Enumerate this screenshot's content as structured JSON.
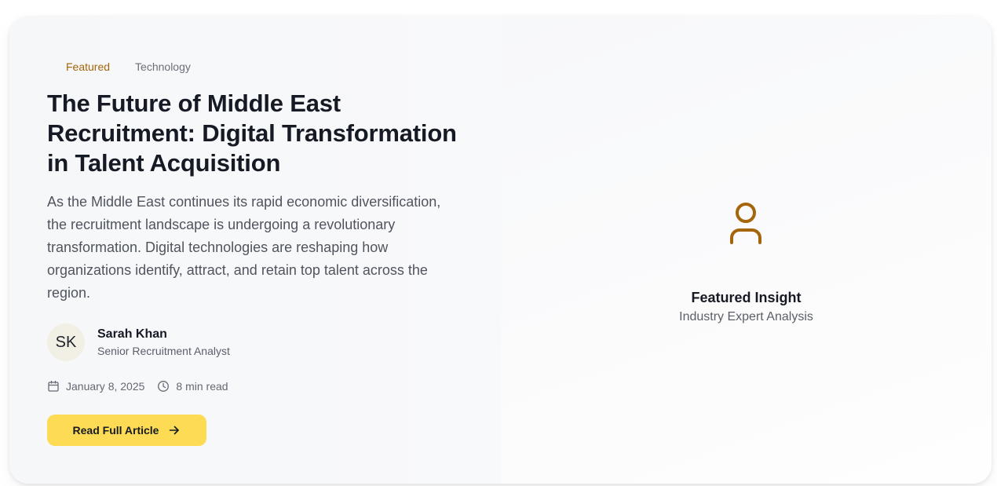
{
  "article": {
    "tags": [
      "Featured",
      "Technology"
    ],
    "title": "The Future of Middle East Recruitment: Digital Transformation in Talent Acquisition",
    "excerpt": "As the Middle East continues its rapid economic diversification, the recruitment landscape is undergoing a revolutionary transformation. Digital technologies are reshaping how organizations identify, attract, and retain top talent across the region.",
    "author": {
      "initials": "SK",
      "name": "Sarah Khan",
      "role": "Senior Recruitment Analyst"
    },
    "date": "January 8, 2025",
    "read_time": "8 min read",
    "cta_label": "Read Full Article"
  },
  "insight": {
    "icon": "user-icon",
    "title": "Featured Insight",
    "subtitle": "Industry Expert Analysis"
  },
  "colors": {
    "accent": "#fddb55",
    "tag_featured": "#a5650a",
    "icon_brown": "#a5650a"
  }
}
